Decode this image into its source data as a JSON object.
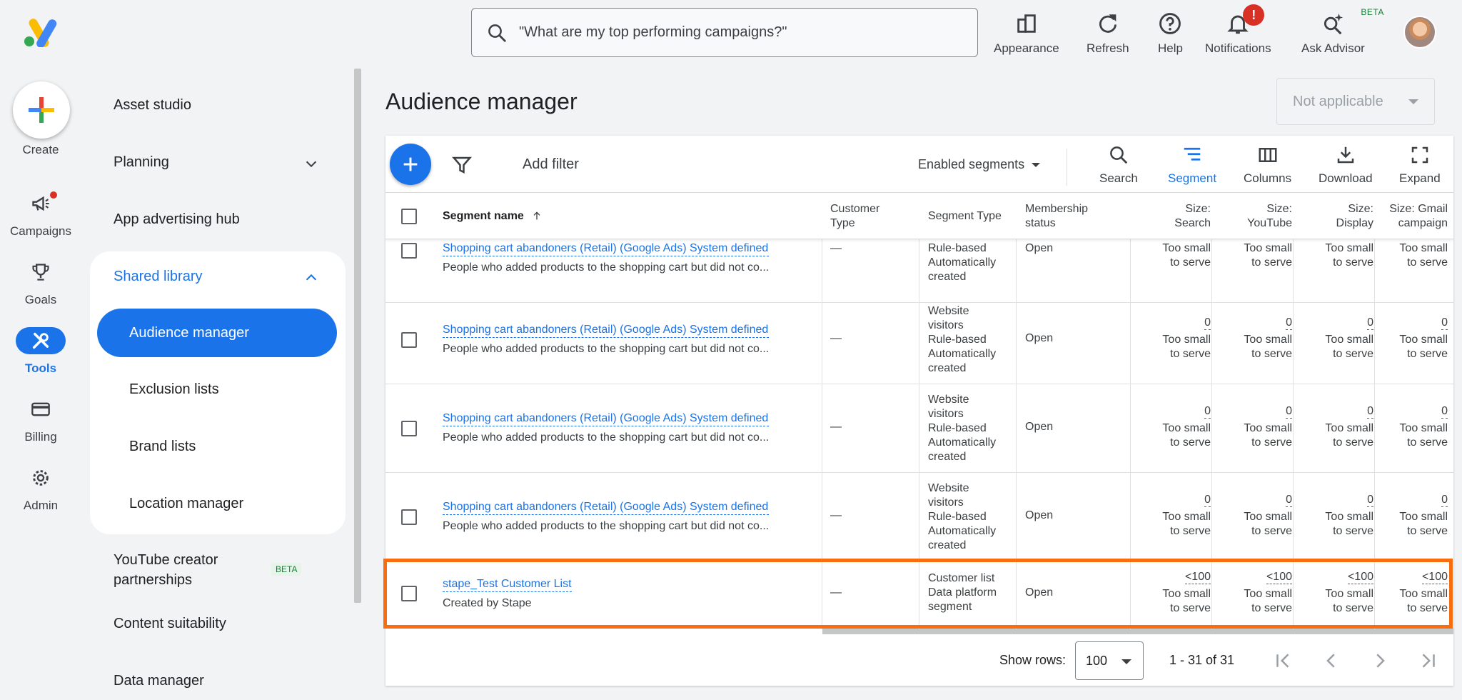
{
  "header": {
    "search_placeholder": "\"What are my top performing campaigns?\"",
    "buttons": {
      "appearance": "Appearance",
      "refresh": "Refresh",
      "help": "Help",
      "notifications": "Notifications",
      "notifications_badge": "!",
      "ask_advisor": "Ask Advisor",
      "ask_advisor_tag": "BETA"
    }
  },
  "rail": {
    "create": "Create",
    "items": [
      {
        "label": "Campaigns",
        "icon": "megaphone-icon"
      },
      {
        "label": "Goals",
        "icon": "trophy-icon"
      },
      {
        "label": "Tools",
        "icon": "tools-icon",
        "active": true
      },
      {
        "label": "Billing",
        "icon": "credit-card-icon"
      },
      {
        "label": "Admin",
        "icon": "gear-icon"
      }
    ]
  },
  "nav": {
    "asset_studio": "Asset studio",
    "planning": "Planning",
    "app_advertising_hub": "App advertising hub",
    "shared_library": "Shared library",
    "audience_manager": "Audience manager",
    "exclusion_lists": "Exclusion lists",
    "brand_lists": "Brand lists",
    "location_manager": "Location manager",
    "youtube_creator_1": "YouTube creator",
    "youtube_creator_2": "partnerships",
    "youtube_creator_tag": "BETA",
    "content_suitability": "Content suitability",
    "data_manager": "Data manager"
  },
  "main": {
    "title": "Audience manager",
    "not_applicable": "Not applicable",
    "add_filter": "Add filter",
    "segments_dropdown": "Enabled segments",
    "tools": {
      "search": "Search",
      "segment": "Segment",
      "columns": "Columns",
      "download": "Download",
      "expand": "Expand"
    }
  },
  "table": {
    "headers": {
      "segment_name": "Segment name",
      "customer_type_1": "Customer",
      "customer_type_2": "Type",
      "segment_type": "Segment Type",
      "membership_1": "Membership",
      "membership_2": "status",
      "size_search_1": "Size:",
      "size_search_2": "Search",
      "size_youtube_1": "Size:",
      "size_youtube_2": "YouTube",
      "size_display_1": "Size:",
      "size_display_2": "Display",
      "size_gmail_1": "Size: Gmail",
      "size_gmail_2": "campaign"
    },
    "rows": [
      {
        "name": "Shopping cart abandoners (Retail) (Google Ads) System defined",
        "desc": "People who added products to the shopping cart but did not co...",
        "customer_type": "—",
        "seg_type": [
          "Rule-based",
          "Automatically",
          "created"
        ],
        "membership": "Open",
        "sizes": [
          "--",
          "--",
          "--",
          "--"
        ],
        "size_note_1": "Too small",
        "size_note_2": "to serve"
      },
      {
        "name": "Shopping cart abandoners (Retail) (Google Ads) System defined",
        "desc": "People who added products to the shopping cart but did not co...",
        "customer_type": "—",
        "seg_type": [
          "Website",
          "visitors",
          "Rule-based",
          "Automatically",
          "created"
        ],
        "membership": "Open",
        "sizes": [
          "0",
          "0",
          "0",
          "0"
        ],
        "size_note_1": "Too small",
        "size_note_2": "to serve"
      },
      {
        "name": "Shopping cart abandoners (Retail) (Google Ads) System defined",
        "desc": "People who added products to the shopping cart but did not co...",
        "customer_type": "—",
        "seg_type": [
          "Website",
          "visitors",
          "Rule-based",
          "Automatically",
          "created"
        ],
        "membership": "Open",
        "sizes": [
          "0",
          "0",
          "0",
          "0"
        ],
        "size_note_1": "Too small",
        "size_note_2": "to serve"
      },
      {
        "name": "Shopping cart abandoners (Retail) (Google Ads) System defined",
        "desc": "People who added products to the shopping cart but did not co...",
        "customer_type": "—",
        "seg_type": [
          "Website",
          "visitors",
          "Rule-based",
          "Automatically",
          "created"
        ],
        "membership": "Open",
        "sizes": [
          "0",
          "0",
          "0",
          "0"
        ],
        "size_note_1": "Too small",
        "size_note_2": "to serve"
      },
      {
        "name": "stape_Test Customer List",
        "desc": "Created by Stape",
        "customer_type": "—",
        "seg_type": [
          "Customer list",
          "Data platform",
          "segment"
        ],
        "membership": "Open",
        "sizes": [
          "<100",
          "<100",
          "<100",
          "<100"
        ],
        "size_note_1": "Too small",
        "size_note_2": "to serve"
      }
    ]
  },
  "footer": {
    "show_rows": "Show rows:",
    "rows_value": "100",
    "range": "1 - 31 of 31"
  },
  "colors": {
    "accent": "#1a73e8",
    "highlight": "#f76d10",
    "alert": "#d93025"
  }
}
